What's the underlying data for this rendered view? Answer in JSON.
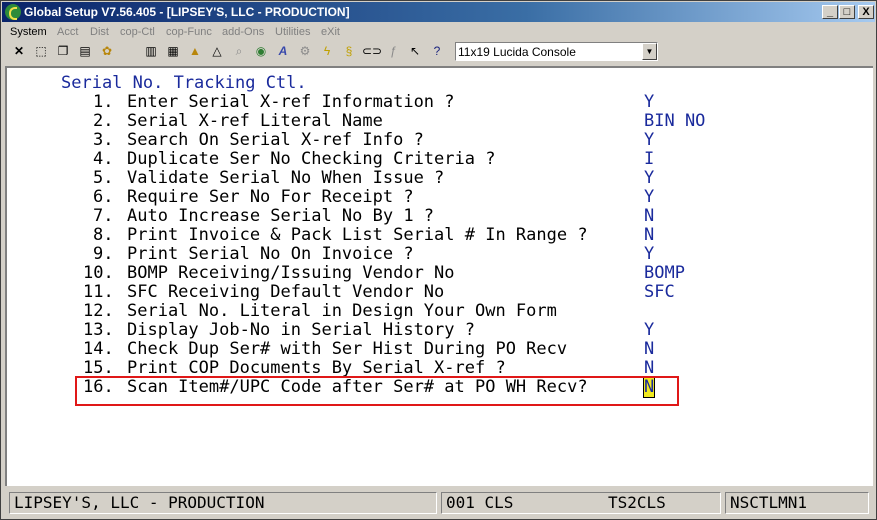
{
  "window": {
    "title": "Global Setup V7.56.405 - [LIPSEY'S, LLC - PRODUCTION]",
    "controls": {
      "minimize": "_",
      "maximize": "□",
      "close": "X"
    }
  },
  "menu": [
    "System",
    "Acct",
    "Dist",
    "cop-Ctl",
    "cop-Func",
    "add-Ons",
    "Utilities",
    "eXit"
  ],
  "toolbar": {
    "font_selector": "11x19 Lucida Console",
    "icons": [
      "close-x-icon",
      "select-icon",
      "copy-icon",
      "paste-icon",
      "settings-icon",
      "notes-icon",
      "print-icon",
      "triangle-icon",
      "search-icon",
      "globe-icon",
      "font-icon",
      "gear-icon",
      "lightning-icon",
      "script-icon",
      "link-icon",
      "function-icon",
      "pointer-icon",
      "stack-icon",
      "help-icon"
    ]
  },
  "screen": {
    "title": "Serial No. Tracking Ctl.",
    "items": [
      {
        "num": "1.",
        "label": "Enter Serial X-ref Information ?",
        "value": "Y"
      },
      {
        "num": "2.",
        "label": "Serial X-ref Literal Name",
        "value": "BIN NO"
      },
      {
        "num": "3.",
        "label": "Search On Serial X-ref Info ?",
        "value": "Y"
      },
      {
        "num": "4.",
        "label": "Duplicate Ser No Checking Criteria ?",
        "value": "I"
      },
      {
        "num": "5.",
        "label": "Validate Serial No When Issue ?",
        "value": "Y"
      },
      {
        "num": "6.",
        "label": "Require Ser No For Receipt ?",
        "value": "Y"
      },
      {
        "num": "7.",
        "label": "Auto Increase Serial No By 1 ?",
        "value": "N"
      },
      {
        "num": "8.",
        "label": "Print Invoice & Pack List Serial # In Range ?",
        "value": "N"
      },
      {
        "num": "9.",
        "label": "Print Serial No On Invoice ?",
        "value": "Y"
      },
      {
        "num": "10.",
        "label": "BOMP Receiving/Issuing Vendor No",
        "value": "BOMP"
      },
      {
        "num": "11.",
        "label": "SFC Receiving Default Vendor No",
        "value": "SFC"
      },
      {
        "num": "12.",
        "label": "Serial No. Literal in Design Your Own Form",
        "value": ""
      },
      {
        "num": "13.",
        "label": "Display Job-No in Serial History ?",
        "value": "Y"
      },
      {
        "num": "14.",
        "label": "Check Dup Ser# with Ser Hist During PO Recv",
        "value": "N"
      },
      {
        "num": "15.",
        "label": "Print COP Documents By Serial X-ref ?",
        "value": "N"
      },
      {
        "num": "16.",
        "label": "Scan Item#/UPC Code after Ser# at PO WH Recv?",
        "value": "N"
      }
    ]
  },
  "status": {
    "company": "LIPSEY'S, LLC - PRODUCTION",
    "session": "001 CLS",
    "terminal": "TS2CLS",
    "program": "NSCTLMN1"
  }
}
